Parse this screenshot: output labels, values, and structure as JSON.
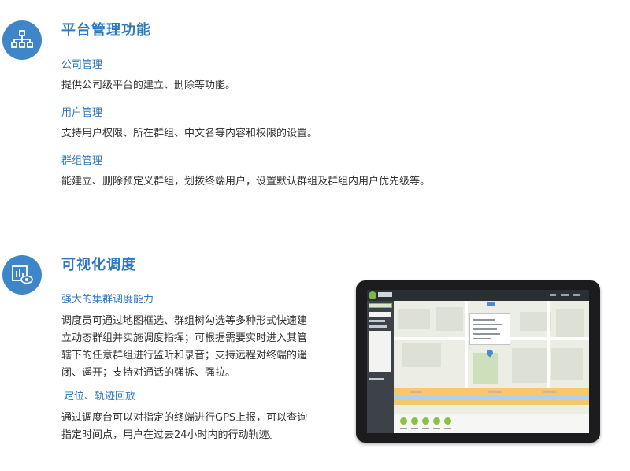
{
  "section1": {
    "icon": "org-chart-icon",
    "title": "平台管理功能",
    "items": [
      {
        "title": "公司管理",
        "desc": "提供公司级平台的建立、删除等功能。"
      },
      {
        "title": "用户管理",
        "desc": "支持用户权限、所在群组、中文名等内容和权限的设置。"
      },
      {
        "title": "群组管理",
        "desc": "能建立、删除预定义群组，划拨终端用户，设置默认群组及群组内用户优先级等。"
      }
    ]
  },
  "section2": {
    "icon": "visual-chart-eye-icon",
    "title": "可视化调度",
    "items": [
      {
        "title": "强大的集群调度能力",
        "lines": [
          "调度员可通过地图框选、群组树勾选等多种形式快速建",
          "立动态群组并实施调度指挥；可根据需要实时进入其管",
          "辖下的任意群组进行监听和录音；支持远程对终端的遥",
          "闭、遥开；支持对通话的强拆、强拉。"
        ]
      },
      {
        "title": "定位、轨迹回放",
        "lines": [
          "通过调度台可以对指定的终端进行GPS上报，可以查询",
          "指定时间点，用户在过去24小时内的行动轨迹。"
        ]
      }
    ]
  },
  "colors": {
    "accent": "#2e78bf",
    "icon_bg": "#3f86c8",
    "divider": "#9cc0e2"
  },
  "tablet_image": "dispatch-console-map-screenshot"
}
